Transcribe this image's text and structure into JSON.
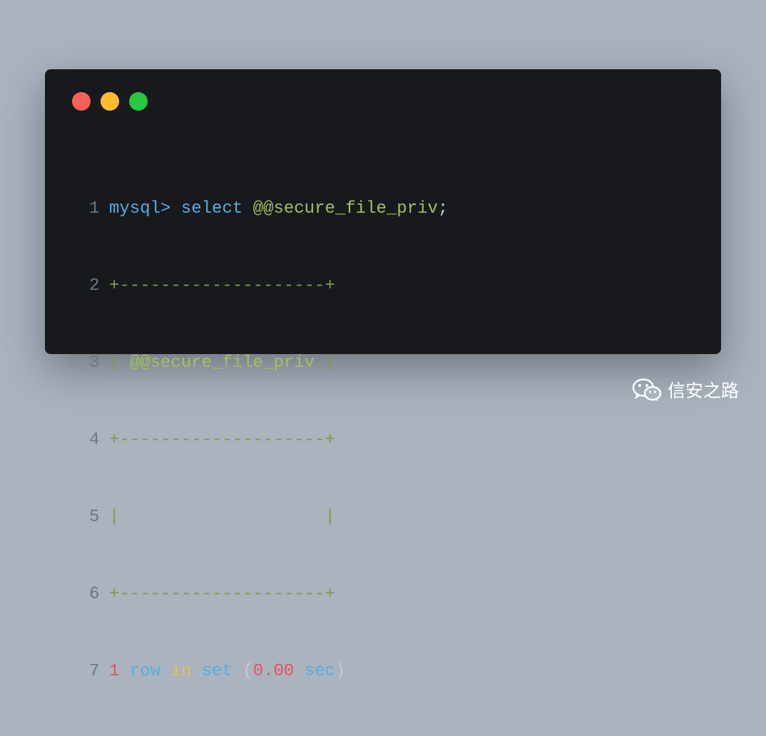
{
  "window": {
    "lights": [
      "close",
      "minimize",
      "maximize"
    ]
  },
  "code": {
    "line_numbers": [
      "1",
      "2",
      "3",
      "4",
      "5",
      "6",
      "7"
    ],
    "line1": {
      "prompt": "mysql>",
      "cmd": "select",
      "var": "@@secure_file_priv",
      "end": ";"
    },
    "line2": {
      "border": "+--------------------+"
    },
    "line3": {
      "pipe_left": "|",
      "var": "@@secure_file_priv",
      "pipe_right": "|"
    },
    "line4": {
      "border": "+--------------------+"
    },
    "line5": {
      "pipe_left": "|",
      "pipe_right": "|"
    },
    "line6": {
      "border": "+--------------------+"
    },
    "line7": {
      "count": "1",
      "row": "row",
      "in": "in",
      "set": "set",
      "paren_open": "(",
      "time": "0.00",
      "sec": "sec",
      "paren_close": ")"
    }
  },
  "colors": {
    "background": "#aab3be",
    "editor": "#17191c",
    "red": "#fc5f57",
    "yellow": "#fdbc2e",
    "green": "#28c840"
  },
  "watermark": {
    "text": "信安之路",
    "icon": "wechat-icon"
  }
}
